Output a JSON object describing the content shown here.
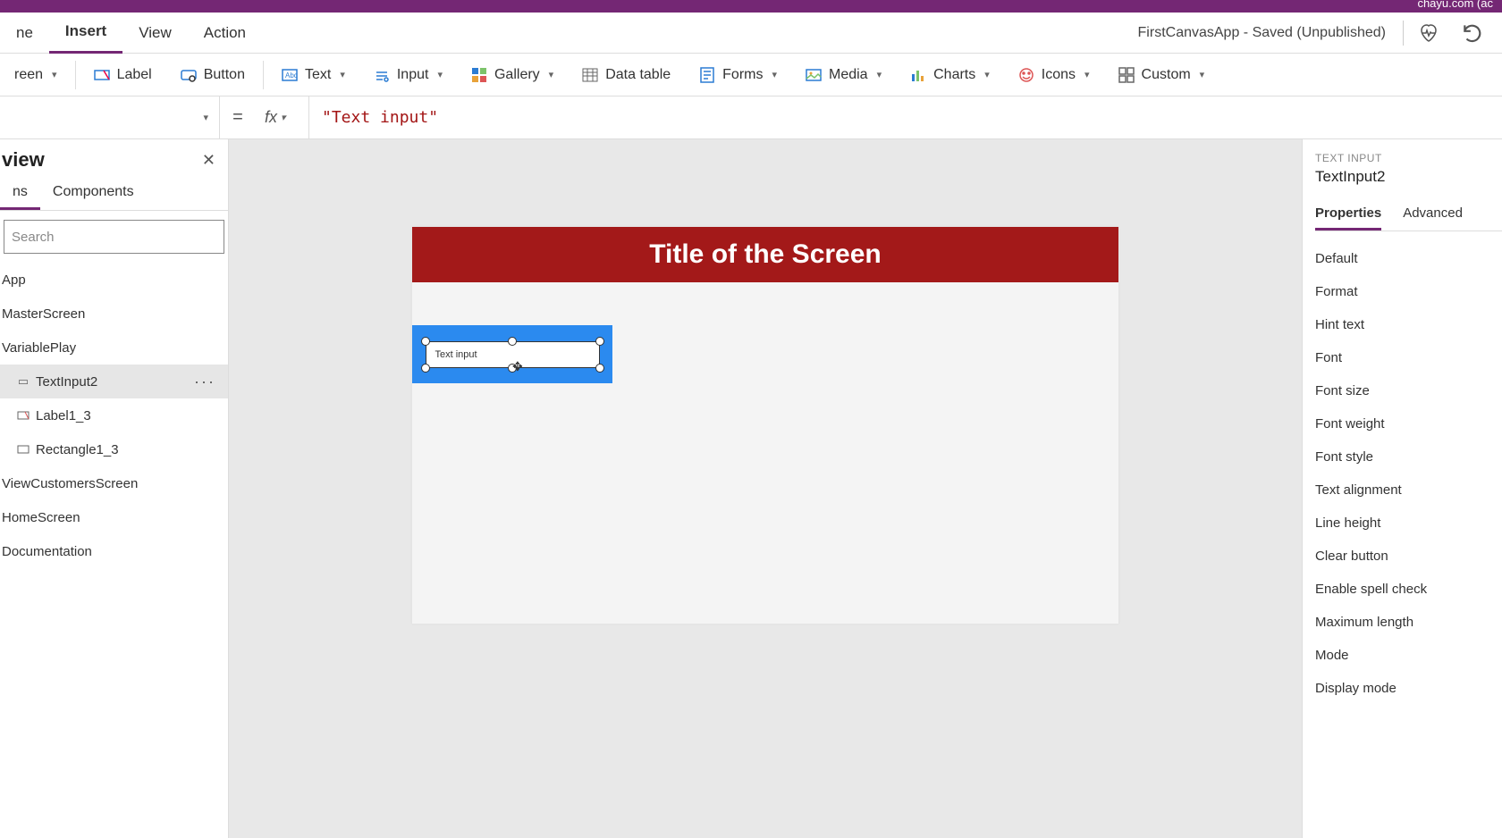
{
  "titlebar": {
    "account": "chayu.com (ac"
  },
  "menubar": {
    "items": [
      "ne",
      "Insert",
      "View",
      "Action"
    ],
    "active_index": 1,
    "app_status": "FirstCanvasApp - Saved (Unpublished)"
  },
  "ribbon": {
    "items": [
      {
        "label": "reen",
        "icon": "screen-icon",
        "chevron": true
      },
      {
        "label": "Label",
        "icon": "label-icon",
        "chevron": false
      },
      {
        "label": "Button",
        "icon": "button-icon",
        "chevron": false
      },
      {
        "label": "Text",
        "icon": "text-icon",
        "chevron": true
      },
      {
        "label": "Input",
        "icon": "input-icon",
        "chevron": true
      },
      {
        "label": "Gallery",
        "icon": "gallery-icon",
        "chevron": true
      },
      {
        "label": "Data table",
        "icon": "datatable-icon",
        "chevron": false
      },
      {
        "label": "Forms",
        "icon": "forms-icon",
        "chevron": true
      },
      {
        "label": "Media",
        "icon": "media-icon",
        "chevron": true
      },
      {
        "label": "Charts",
        "icon": "charts-icon",
        "chevron": true
      },
      {
        "label": "Icons",
        "icon": "icons-icon",
        "chevron": true
      },
      {
        "label": "Custom",
        "icon": "custom-icon",
        "chevron": true
      }
    ]
  },
  "formulabar": {
    "fx_label": "fx",
    "formula": "\"Text input\""
  },
  "tree": {
    "title": "view",
    "tabs": [
      "ns",
      "Components"
    ],
    "active_tab": 0,
    "search_placeholder": "Search",
    "items": [
      {
        "label": "App",
        "indent": false,
        "selected": false
      },
      {
        "label": "MasterScreen",
        "indent": false,
        "selected": false
      },
      {
        "label": "VariablePlay",
        "indent": false,
        "selected": false
      },
      {
        "label": "TextInput2",
        "indent": true,
        "selected": true,
        "icon": "textinput-ctrl-icon"
      },
      {
        "label": "Label1_3",
        "indent": true,
        "selected": false,
        "icon": "label-ctrl-icon"
      },
      {
        "label": "Rectangle1_3",
        "indent": true,
        "selected": false,
        "icon": "rect-ctrl-icon"
      },
      {
        "label": "ViewCustomersScreen",
        "indent": false,
        "selected": false
      },
      {
        "label": "HomeScreen",
        "indent": false,
        "selected": false
      },
      {
        "label": "Documentation",
        "indent": false,
        "selected": false
      }
    ]
  },
  "canvas": {
    "title_text": "Title of the Screen",
    "text_input_placeholder": "Text input"
  },
  "props": {
    "type_label": "TEXT INPUT",
    "name": "TextInput2",
    "tabs": [
      "Properties",
      "Advanced"
    ],
    "active_tab": 0,
    "rows": [
      "Default",
      "Format",
      "Hint text",
      "Font",
      "Font size",
      "Font weight",
      "Font style",
      "Text alignment",
      "Line height",
      "Clear button",
      "Enable spell check",
      "Maximum length",
      "Mode",
      "Display mode"
    ]
  }
}
